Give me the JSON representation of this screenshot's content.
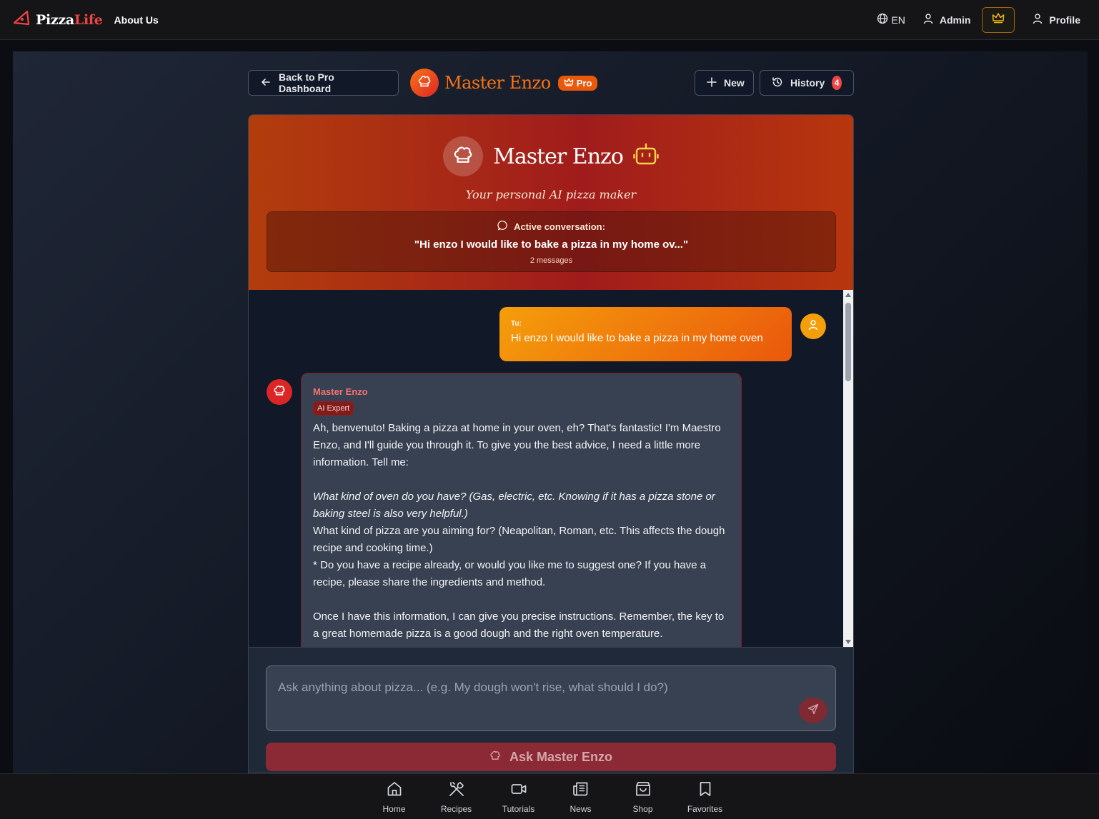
{
  "topnav": {
    "logo_part1": "Pizza",
    "logo_part2": "Life",
    "about": "About Us",
    "language": "EN",
    "admin": "Admin",
    "profile": "Profile"
  },
  "toolbar": {
    "back": "Back to Pro Dashboard",
    "title": "Master Enzo",
    "pro": "Pro",
    "new": "New",
    "history": "History",
    "history_count": "4"
  },
  "hero": {
    "title": "Master Enzo",
    "subtitle": "Your personal AI pizza maker",
    "active_label": "Active conversation:",
    "active_quote": "\"Hi enzo I would like to bake a pizza in my home ov...\"",
    "message_count": "2 messages"
  },
  "messages": {
    "user_label": "Tu:",
    "user_text": "Hi enzo I would like to bake a pizza in my home oven",
    "bot_name": "Master Enzo",
    "bot_badge": "AI Expert",
    "bot_p1": "Ah, benvenuto! Baking a pizza at home in your oven, eh? That's fantastic! I'm Maestro Enzo, and I'll guide you through it. To give you the best advice, I need a little more information. Tell me:",
    "bot_p2": "What kind of oven do you have? (Gas, electric, etc. Knowing if it has a pizza stone or baking steel is also very helpful.)",
    "bot_p3": "What kind of pizza are you aiming for? (Neapolitan, Roman, etc. This affects the dough recipe and cooking time.)",
    "bot_p4": "* Do you have a recipe already, or would you like me to suggest one? If you have a recipe, please share the ingredients and method.",
    "bot_p5": "Once I have this information, I can give you precise instructions. Remember, the key to a great homemade pizza is a good dough and the right oven temperature."
  },
  "input": {
    "placeholder": "Ask anything about pizza... (e.g. My dough won't rise, what should I do?)",
    "ask_button": "Ask Master Enzo"
  },
  "bottomnav": {
    "items": [
      {
        "label": "Home",
        "icon": "home-icon"
      },
      {
        "label": "Recipes",
        "icon": "utensils-icon"
      },
      {
        "label": "Tutorials",
        "icon": "video-icon"
      },
      {
        "label": "News",
        "icon": "newspaper-icon"
      },
      {
        "label": "Shop",
        "icon": "shopping-bag-icon"
      },
      {
        "label": "Favorites",
        "icon": "bookmark-icon"
      }
    ]
  },
  "colors": {
    "accent": "#f97316",
    "brand_red": "#dc2626",
    "user_bubble": "#f59e0b"
  }
}
